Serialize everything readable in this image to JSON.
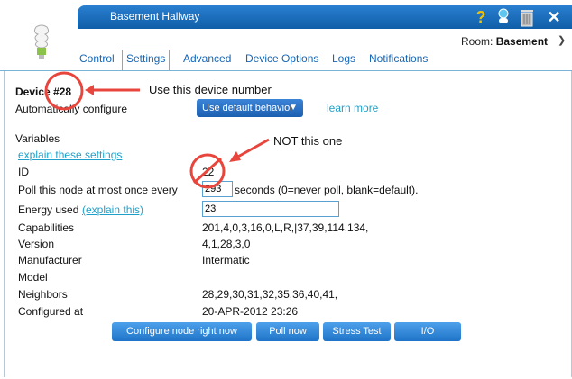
{
  "window": {
    "title": "Basement Hallway"
  },
  "room": {
    "label": "Room:",
    "value": "Basement"
  },
  "tabs": [
    {
      "label": "Control"
    },
    {
      "label": "Settings"
    },
    {
      "label": "Advanced"
    },
    {
      "label": "Device Options"
    },
    {
      "label": "Logs"
    },
    {
      "label": "Notifications"
    }
  ],
  "device": {
    "heading": "Device #28",
    "auto_config_label": "Automatically configure",
    "auto_config_value": "Use default behavior",
    "learn_more": "learn more",
    "variables_label": "Variables",
    "explain_settings": "explain these settings"
  },
  "fields": {
    "id_label": "ID",
    "id_value": "22",
    "poll_label": "Poll this node at most once every",
    "poll_value": "293",
    "poll_suffix": "seconds (0=never poll, blank=default).",
    "energy_label": "Energy used",
    "energy_link": "(explain this)",
    "energy_value": "23",
    "capabilities_label": "Capabilities",
    "capabilities_value": "201,4,0,3,16,0,L,R,|37,39,114,134,",
    "version_label": "Version",
    "version_value": "4,1,28,3,0",
    "manufacturer_label": "Manufacturer",
    "manufacturer_value": "Intermatic",
    "model_label": "Model",
    "neighbors_label": "Neighbors",
    "neighbors_value": "28,29,30,31,32,35,36,40,41,",
    "configured_label": "Configured at",
    "configured_value": "20-APR-2012 23:26"
  },
  "buttons": {
    "configure": "Configure node right now",
    "poll": "Poll now",
    "stress": "Stress Test",
    "io": "I/O"
  },
  "annotations": {
    "use_this": "Use this device number",
    "not_this": "NOT this one"
  },
  "colors": {
    "titlebar": "#1566b6",
    "button": "#2a85d8",
    "link": "#20a0c8",
    "annotation": "#e8453c"
  },
  "icons": [
    "help-icon",
    "user-icon",
    "trash-icon",
    "close-icon",
    "bulb-icon",
    "chevron-down-icon"
  ]
}
